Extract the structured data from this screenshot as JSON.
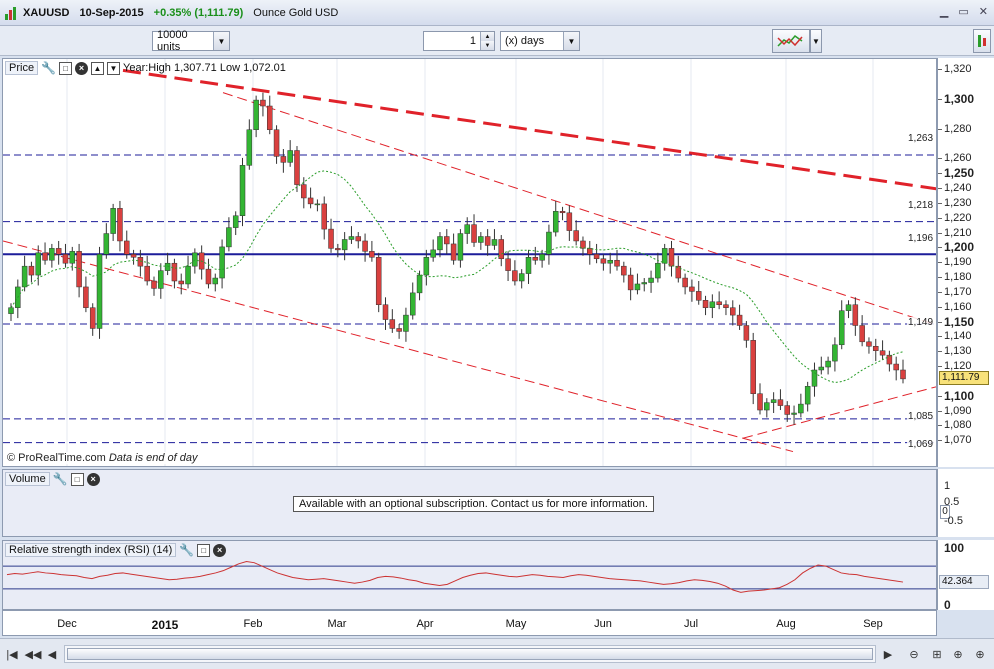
{
  "window": {
    "symbol": "XAUUSD",
    "date": "10-Sep-2015",
    "change": "+0.35% (1,111.79)",
    "instrument": "Ounce Gold USD"
  },
  "toolbar": {
    "units_value": "10000 units",
    "period_value": "1",
    "period_unit": "(x) days"
  },
  "price_panel": {
    "title": "Price",
    "year_range": "Year:High 1,307.71 Low 1,072.01",
    "copyright": "© ProRealTime.com",
    "note": "Data is end of day",
    "levels": [
      "1,263",
      "1,218",
      "1,196",
      "1,149",
      "1,085",
      "1,069"
    ],
    "current_price": "1,111.79",
    "axis_labels": [
      "1,320",
      "1,300",
      "1,280",
      "1,260",
      "1,250",
      "1,240",
      "1,230",
      "1,220",
      "1,210",
      "1,200",
      "1,190",
      "1,180",
      "1,170",
      "1,160",
      "1,150",
      "1,140",
      "1,130",
      "1,120",
      "1,100",
      "1,090",
      "1,080",
      "1,070"
    ]
  },
  "volume_panel": {
    "title": "Volume",
    "message": "Available with an optional subscription. Contact us for more information.",
    "axis_labels": [
      "1",
      "0.5",
      "0",
      "-0.5"
    ]
  },
  "rsi_panel": {
    "title": "Relative strength index (RSI) (14)",
    "value": "42.364",
    "axis_labels": [
      "100",
      "0"
    ]
  },
  "x_axis": {
    "labels": [
      "Dec",
      "2015",
      "Feb",
      "Mar",
      "Apr",
      "May",
      "Jun",
      "Jul",
      "Aug",
      "Sep"
    ]
  },
  "colors": {
    "up_candle": "#33b533",
    "down_candle": "#d9403f",
    "trend_line": "#e0222a",
    "support": "#1c1c9a"
  },
  "chart_data": {
    "type": "candlestick",
    "title": "XAUUSD",
    "ylim": [
      1060,
      1325
    ],
    "close": [
      1160,
      1174,
      1188,
      1182,
      1197,
      1192,
      1200,
      1196,
      1190,
      1198,
      1174,
      1160,
      1146,
      1196,
      1210,
      1227,
      1205,
      1196,
      1194,
      1188,
      1178,
      1173,
      1185,
      1190,
      1178,
      1176,
      1188,
      1197,
      1186,
      1176,
      1180,
      1201,
      1214,
      1222,
      1256,
      1280,
      1300,
      1296,
      1280,
      1262,
      1258,
      1266,
      1243,
      1234,
      1230,
      1230,
      1213,
      1200,
      1199,
      1206,
      1208,
      1205,
      1198,
      1194,
      1162,
      1152,
      1146,
      1144,
      1155,
      1170,
      1182,
      1194,
      1199,
      1208,
      1203,
      1192,
      1210,
      1216,
      1204,
      1208,
      1202,
      1206,
      1193,
      1185,
      1178,
      1183,
      1194,
      1192,
      1196,
      1211,
      1225,
      1224,
      1212,
      1205,
      1200,
      1196,
      1193,
      1190,
      1192,
      1188,
      1182,
      1172,
      1176,
      1177,
      1180,
      1190,
      1200,
      1188,
      1180,
      1174,
      1171,
      1165,
      1160,
      1164,
      1162,
      1160,
      1155,
      1148,
      1138,
      1102,
      1091,
      1096,
      1098,
      1094,
      1088,
      1089,
      1095,
      1107,
      1118,
      1120,
      1124,
      1135,
      1158,
      1162,
      1148,
      1137,
      1134,
      1131,
      1128,
      1122,
      1118,
      1112
    ],
    "rsi": [
      55,
      57,
      56,
      58,
      60,
      58,
      57,
      55,
      54,
      53,
      50,
      48,
      52,
      54,
      57,
      58,
      56,
      54,
      52,
      50,
      48,
      46,
      47,
      49,
      50,
      52,
      55,
      58,
      62,
      68,
      74,
      78,
      76,
      70,
      64,
      58,
      54,
      50,
      48,
      46,
      47,
      48,
      46,
      44,
      42,
      40,
      42,
      45,
      50,
      52,
      51,
      49,
      46,
      44,
      40,
      38,
      36,
      38,
      44,
      50,
      54,
      57,
      58,
      56,
      54,
      52,
      51,
      53,
      55,
      54,
      52,
      51,
      50,
      53,
      55,
      54,
      52,
      50,
      48,
      47,
      46,
      45,
      44,
      42,
      40,
      38,
      39,
      41,
      44,
      46,
      45,
      43,
      40,
      35,
      28,
      24,
      26,
      27,
      28,
      30,
      32,
      38,
      46,
      58,
      66,
      72,
      70,
      64,
      58,
      56,
      55,
      52,
      50,
      48,
      46,
      44,
      42
    ]
  }
}
